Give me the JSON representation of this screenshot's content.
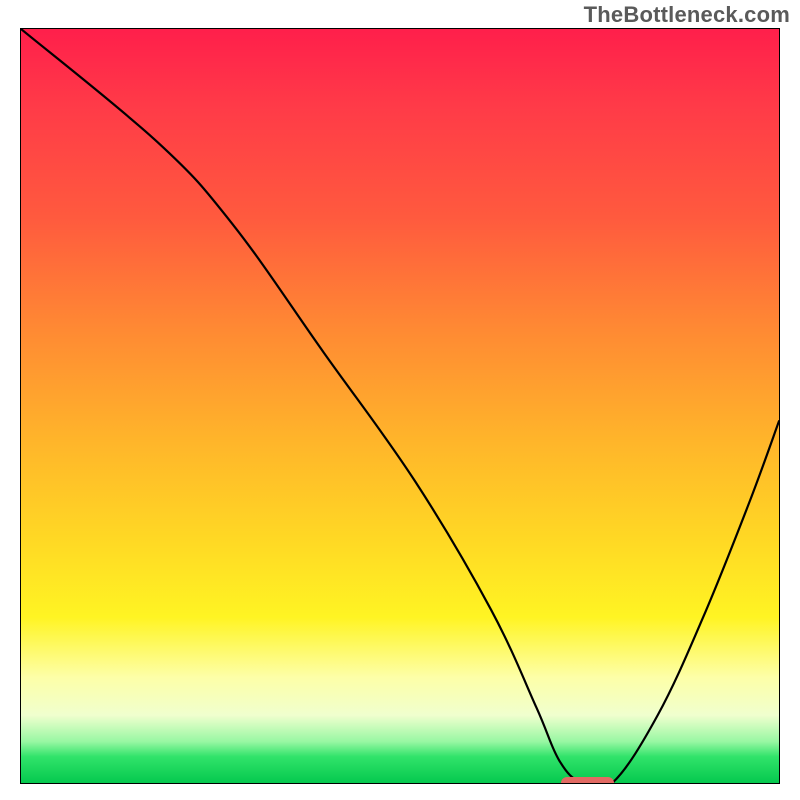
{
  "watermark": "TheBottleneck.com",
  "chart_data": {
    "type": "line",
    "title": "",
    "xlabel": "",
    "ylabel": "",
    "xlim": [
      0,
      100
    ],
    "ylim": [
      0,
      100
    ],
    "grid": false,
    "series": [
      {
        "name": "curve",
        "x": [
          0,
          18,
          28,
          40,
          52,
          62,
          68,
          71,
          74,
          78,
          84,
          90,
          96,
          100
        ],
        "values": [
          100,
          85,
          74,
          57,
          40,
          23,
          10,
          3,
          0,
          0,
          9,
          22,
          37,
          48
        ]
      }
    ],
    "marker": {
      "x_start": 71,
      "x_end": 78,
      "y": 0,
      "color": "#e26a63"
    },
    "background_gradient": {
      "top_color": "#ff1f4b",
      "bottom_color": "#05c94e"
    }
  }
}
